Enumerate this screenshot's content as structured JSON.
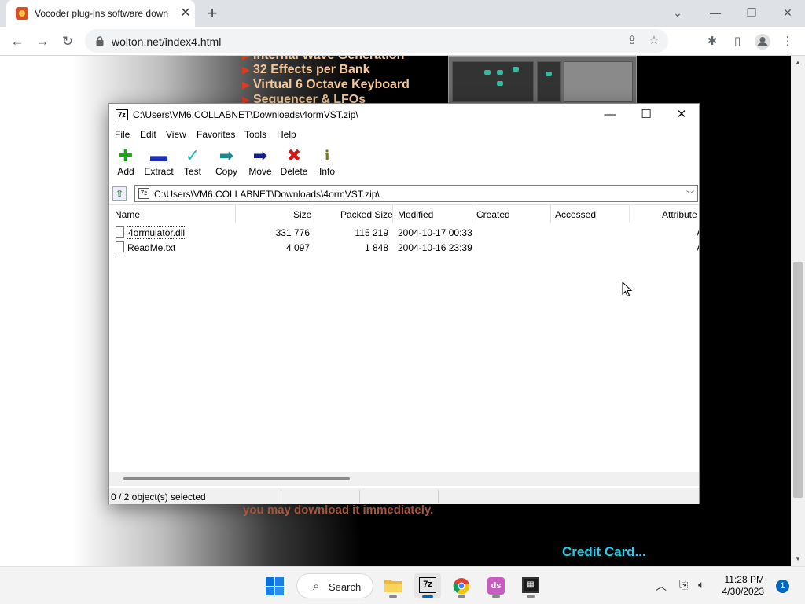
{
  "browser": {
    "tab_title": "Vocoder plug-ins software down",
    "url": "wolton.net/index4.html"
  },
  "page": {
    "features": [
      "Internal Wave Generation",
      "32 Effects per Bank",
      "Virtual 6 Octave Keyboard",
      "Sequencer & LFOs"
    ],
    "download_text": "you may download it immediately.",
    "credit_link": "Credit Card..."
  },
  "zip": {
    "title": "C:\\Users\\VM6.COLLABNET\\Downloads\\4ormVST.zip\\",
    "menu": [
      "File",
      "Edit",
      "View",
      "Favorites",
      "Tools",
      "Help"
    ],
    "tools": [
      {
        "label": "Add",
        "icon": "plus-icon",
        "color": "#22a022"
      },
      {
        "label": "Extract",
        "icon": "minus-icon",
        "color": "#1f2fb8"
      },
      {
        "label": "Test",
        "icon": "check-icon",
        "color": "#1fb5b5"
      },
      {
        "label": "Copy",
        "icon": "double-arrow-icon",
        "color": "#1a8a8a"
      },
      {
        "label": "Move",
        "icon": "arrow-right-icon",
        "color": "#15208a"
      },
      {
        "label": "Delete",
        "icon": "delete-x-icon",
        "color": "#d01818"
      },
      {
        "label": "Info",
        "icon": "info-icon",
        "color": "#7a7a10"
      }
    ],
    "path": "C:\\Users\\VM6.COLLABNET\\Downloads\\4ormVST.zip\\",
    "columns": [
      "Name",
      "Size",
      "Packed Size",
      "Modified",
      "Created",
      "Accessed",
      "Attribute"
    ],
    "files": [
      {
        "name": "4ormulator.dll",
        "size": "331 776",
        "packed": "115 219",
        "modified": "2004-10-17 00:33",
        "attr": "A"
      },
      {
        "name": "ReadMe.txt",
        "size": "4 097",
        "packed": "1 848",
        "modified": "2004-10-16 23:39",
        "attr": "A"
      }
    ],
    "status": "0 / 2 object(s) selected"
  },
  "taskbar": {
    "search_label": "Search",
    "time": "11:28 PM",
    "date": "4/30/2023",
    "notifications": "1"
  }
}
